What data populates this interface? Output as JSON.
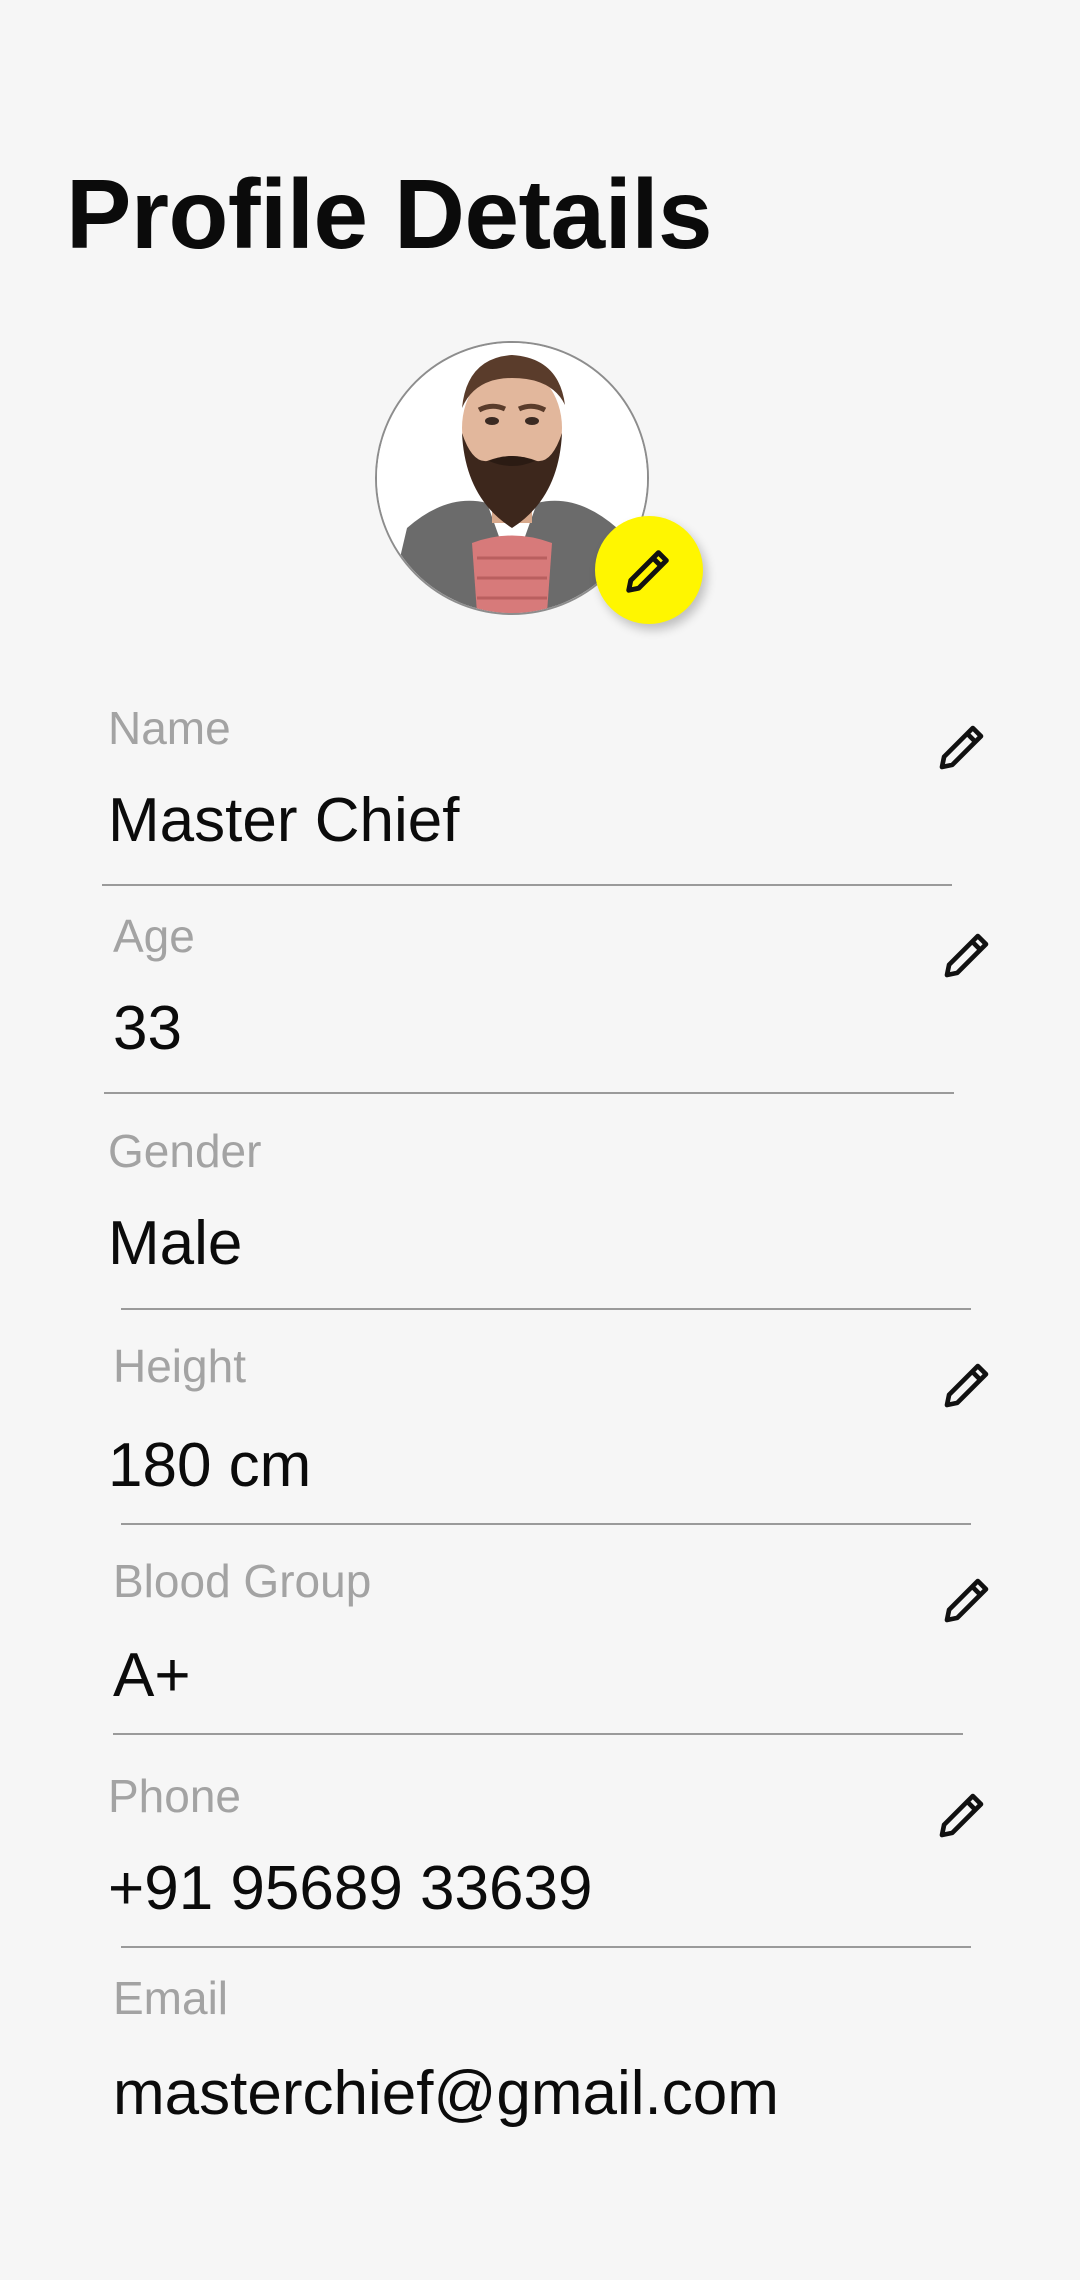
{
  "header": {
    "title": "Profile Details"
  },
  "avatar": {
    "alt": "profile photo",
    "edit_icon": "pencil-icon",
    "edit_color": "#fff600"
  },
  "fields": {
    "name": {
      "label": "Name",
      "value": "Master Chief",
      "editable": true
    },
    "age": {
      "label": "Age",
      "value": "33",
      "editable": true
    },
    "gender": {
      "label": "Gender",
      "value": "Male",
      "editable": false
    },
    "height": {
      "label": "Height",
      "value": "180 cm",
      "editable": true
    },
    "blood_group": {
      "label": "Blood Group",
      "value": "A+",
      "editable": true
    },
    "phone": {
      "label": "Phone",
      "value": "+91 95689 33639",
      "editable": true
    },
    "email": {
      "label": "Email",
      "value": "masterchief@gmail.com",
      "editable": false
    }
  },
  "icons": {
    "edit": "pencil-icon"
  }
}
